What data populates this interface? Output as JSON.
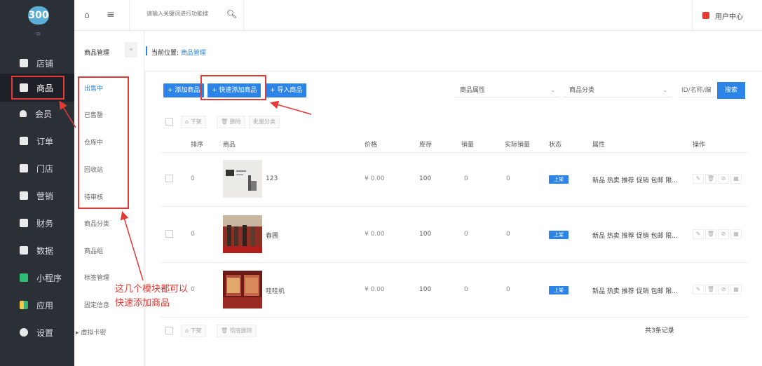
{
  "logo_text": "300",
  "sidebar": {
    "collapse_glyph": "·≡",
    "items": [
      {
        "label": "店铺",
        "icon": "store-icon"
      },
      {
        "label": "商品",
        "icon": "goods-icon"
      },
      {
        "label": "会员",
        "icon": "member-icon"
      },
      {
        "label": "订单",
        "icon": "order-icon"
      },
      {
        "label": "门店",
        "icon": "shop-icon"
      },
      {
        "label": "营销",
        "icon": "marketing-icon"
      },
      {
        "label": "财务",
        "icon": "finance-icon"
      },
      {
        "label": "数据",
        "icon": "data-icon"
      },
      {
        "label": "小程序",
        "icon": "miniapp-icon"
      },
      {
        "label": "应用",
        "icon": "apps-icon"
      },
      {
        "label": "设置",
        "icon": "settings-icon"
      }
    ]
  },
  "topbar": {
    "search_placeholder": "请输入关键词进行功能搜",
    "user_center": "用户中心"
  },
  "subnav": {
    "title": "商品管理",
    "fold": "«",
    "items": [
      "出售中",
      "已售罄",
      "仓库中",
      "回收站",
      "待审核",
      "商品分类",
      "商品组",
      "标签管理",
      "固定信息",
      "▸ 虚拟卡密"
    ]
  },
  "breadcrumb": {
    "prefix": "当前位置:",
    "current": "商品管理"
  },
  "toolbar": {
    "add": "+ 添加商品",
    "quick_add": "+ 快速添加商品",
    "import": "+ 导入商品",
    "attr_select": "商品属性",
    "cat_select": "商品分类",
    "id_placeholder": "ID/名称/编",
    "search": "搜索"
  },
  "batch": {
    "off_shelf": "⌂ 下架",
    "delete": "🗑 删除",
    "batch_cat": "批量分类",
    "perm_delete": "🗑 彻底删除"
  },
  "table": {
    "headers": [
      "排序",
      "商品",
      "价格",
      "库存",
      "销量",
      "实际销量",
      "状态",
      "属性",
      "操作"
    ],
    "rows": [
      {
        "sort": "0",
        "name": "123",
        "price": "¥ 0.00",
        "stock": "100",
        "sales": "0",
        "actual": "0",
        "status": "上架",
        "attrs": "新品 热卖 推荐 促销 包邮 限..."
      },
      {
        "sort": "0",
        "name": "春圃",
        "price": "¥ 0.00",
        "stock": "100",
        "sales": "0",
        "actual": "0",
        "status": "上架",
        "attrs": "新品 热卖 推荐 促销 包邮 限..."
      },
      {
        "sort": "0",
        "name": "哇哇机",
        "price": "¥ 0.00",
        "stock": "100",
        "sales": "0",
        "actual": "0",
        "status": "上架",
        "attrs": "新品 热卖 推荐 促销 包邮 限..."
      }
    ],
    "total": "共3条记录"
  },
  "annotation": {
    "line1": "这几个模块都可以",
    "line2": "快速添加商品"
  },
  "colors": {
    "accent": "#2c84e8",
    "sidebar_bg": "#2b2f36",
    "annotation": "#e53935"
  }
}
